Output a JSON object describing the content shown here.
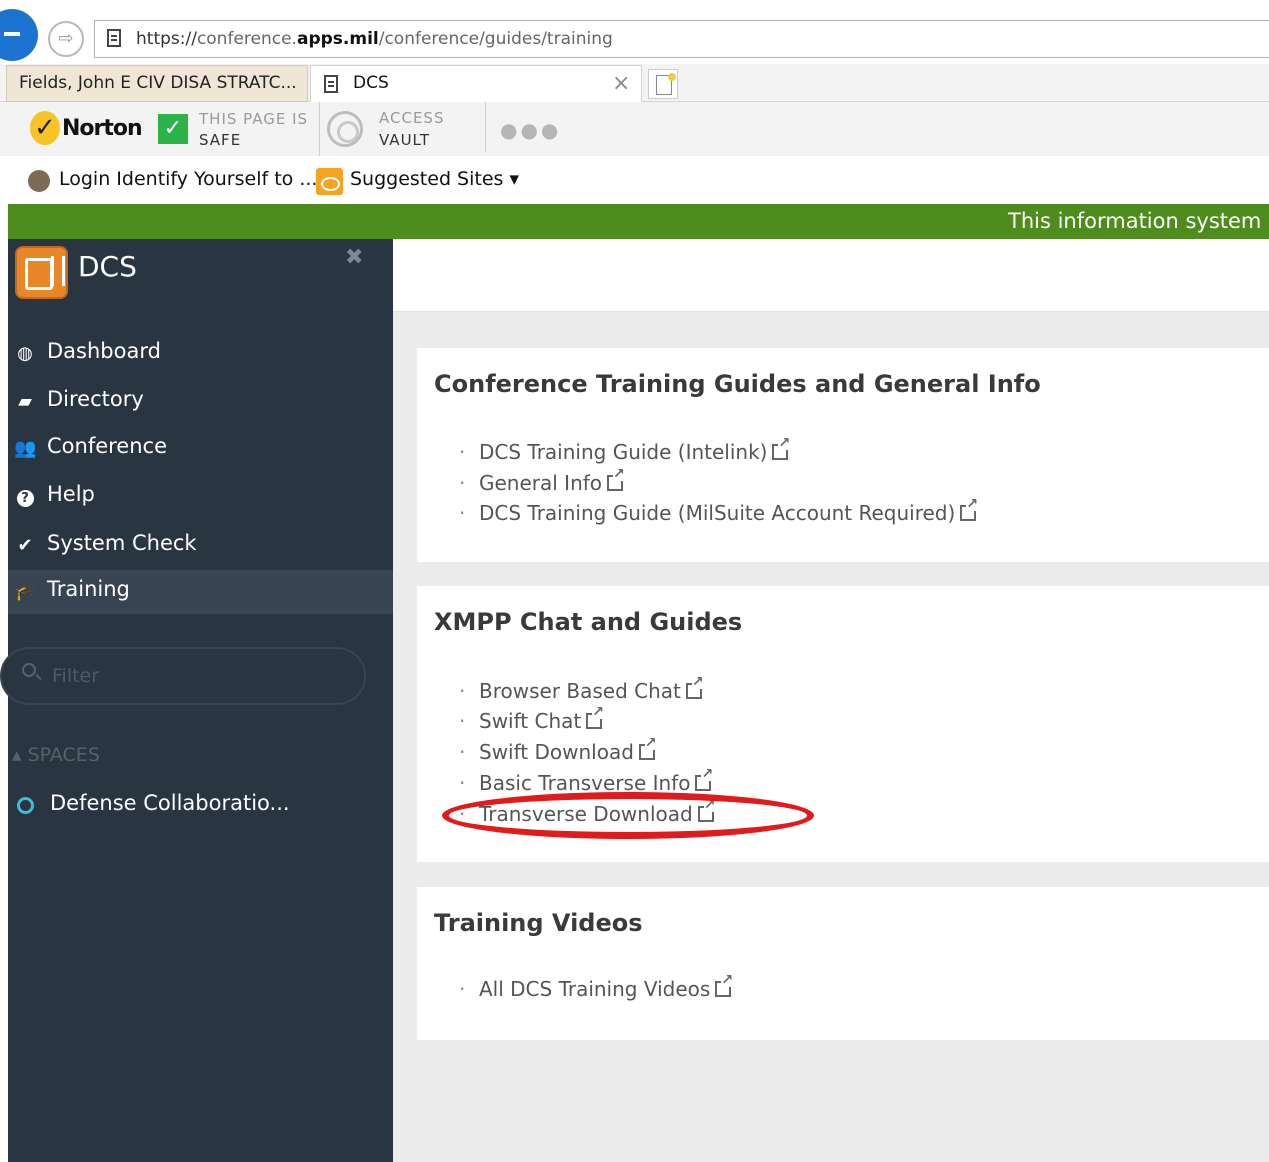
{
  "browser": {
    "url_scheme": "https://",
    "url_host_prefix": "conference.",
    "url_host": "apps.mil",
    "url_path": "/conference/guides/training",
    "tabs": [
      {
        "label": "Fields, John E CIV DISA STRATC..."
      },
      {
        "label": "DCS",
        "close": "×"
      }
    ],
    "toolbar": {
      "norton_check": "✓",
      "norton_label": "Norton",
      "safe_line1": "THIS PAGE IS",
      "safe_line2": "SAFE",
      "vault_line1": "ACCESS",
      "vault_line2": "VAULT",
      "more": "●●●"
    },
    "favorites": [
      {
        "label": "Login  Identify Yourself to ..."
      },
      {
        "label": "Suggested Sites ▾"
      }
    ]
  },
  "banner": {
    "text": "This information system"
  },
  "sidebar": {
    "brand": "DCS",
    "close": "✖",
    "nav": [
      {
        "label": "Dashboard",
        "icon": "dashboard-icon",
        "glyph": "◍"
      },
      {
        "label": "Directory",
        "icon": "book-icon",
        "glyph": "▰"
      },
      {
        "label": "Conference",
        "icon": "users-icon",
        "glyph": "👥"
      },
      {
        "label": "Help",
        "icon": "question-icon",
        "glyph": "?"
      },
      {
        "label": "System Check",
        "icon": "check-icon",
        "glyph": "✔"
      },
      {
        "label": "Training",
        "icon": "graduation-cap-icon",
        "glyph": "🎓",
        "active": true
      }
    ],
    "filter_placeholder": "Filter",
    "spaces_header": "▴ SPACES",
    "spaces": [
      {
        "label": "Defense Collaboratio..."
      }
    ]
  },
  "cards": [
    {
      "title": "Conference Training Guides and General Info",
      "links": [
        "DCS Training Guide (Intelink)",
        "General Info",
        "DCS Training Guide (MilSuite Account Required)"
      ]
    },
    {
      "title": "XMPP Chat and Guides",
      "links": [
        "Browser Based Chat",
        "Swift Chat",
        "Swift Download",
        "Basic Transverse Info",
        "Transverse Download"
      ]
    },
    {
      "title": "Training Videos",
      "links": [
        "All DCS Training Videos"
      ]
    }
  ],
  "colors": {
    "banner": "#4e8c1d",
    "sidebar": "#2a3542",
    "highlight": "#e11b1b"
  }
}
